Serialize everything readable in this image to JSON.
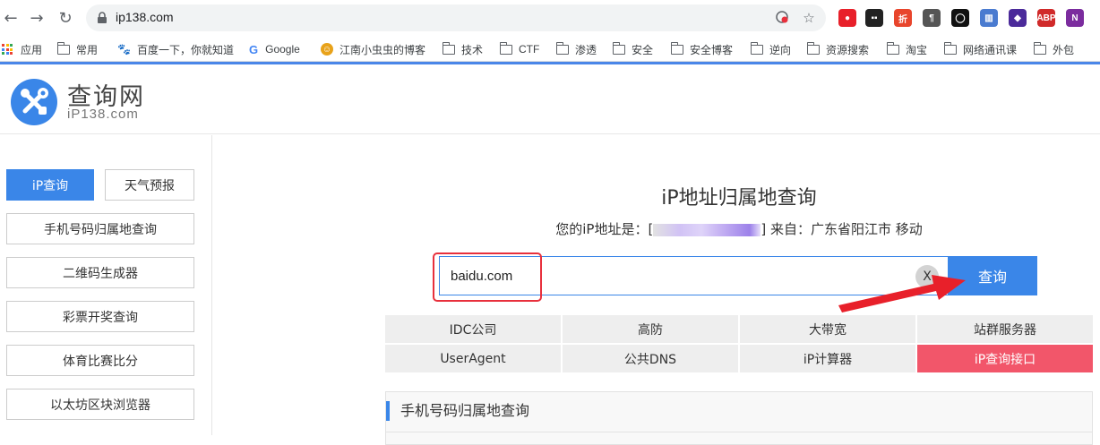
{
  "browser": {
    "url": "ip138.com",
    "nav": {
      "back": "←",
      "forward": "→",
      "reload": "↻"
    },
    "extensions": [
      {
        "name": "ublock-icon",
        "label": "●",
        "color": "#e8202a"
      },
      {
        "name": "tampermonkey-icon",
        "label": "▪▪",
        "color": "#222222"
      },
      {
        "name": "zhe-icon",
        "label": "折",
        "color": "#e8452c"
      },
      {
        "name": "pilcrow-icon",
        "label": "¶",
        "color": "#555555"
      },
      {
        "name": "circle-icon",
        "label": "◯",
        "color": "#111111"
      },
      {
        "name": "barcode-icon",
        "label": "▥",
        "color": "#4a7bd0"
      },
      {
        "name": "cube-icon",
        "label": "◆",
        "color": "#4b2a9a"
      },
      {
        "name": "abp-icon",
        "label": "ABP",
        "color": "#d02a2a"
      },
      {
        "name": "onenote-icon",
        "label": "N",
        "color": "#7b2c9e"
      }
    ]
  },
  "bookmarks": [
    {
      "label": "应用",
      "icon": "apps"
    },
    {
      "label": "常用",
      "icon": "folder"
    },
    {
      "label": "百度一下，你就知道",
      "icon": "baidu"
    },
    {
      "label": "Google",
      "icon": "google"
    },
    {
      "label": "江南小虫虫的博客",
      "icon": "blog"
    },
    {
      "label": "技术",
      "icon": "folder"
    },
    {
      "label": "CTF",
      "icon": "folder"
    },
    {
      "label": "渗透",
      "icon": "folder"
    },
    {
      "label": "安全",
      "icon": "folder"
    },
    {
      "label": "安全博客",
      "icon": "folder"
    },
    {
      "label": "逆向",
      "icon": "folder"
    },
    {
      "label": "资源搜索",
      "icon": "folder"
    },
    {
      "label": "淘宝",
      "icon": "folder"
    },
    {
      "label": "网络通讯课",
      "icon": "folder"
    },
    {
      "label": "外包",
      "icon": "folder"
    }
  ],
  "site": {
    "title": "查询网",
    "subtitle": "iP138.com"
  },
  "sidebar": {
    "tabs": [
      "iP查询",
      "天气预报"
    ],
    "items": [
      "手机号码归属地查询",
      "二维码生成器",
      "彩票开奖查询",
      "体育比赛比分",
      "以太坊区块浏览器"
    ]
  },
  "main": {
    "heading": "iP地址归属地查询",
    "your_ip_prefix": "您的iP地址是：[",
    "your_ip_suffix": "] 来自：广东省阳江市 移动",
    "search_value": "baidu.com",
    "clear_label": "X",
    "query_label": "查询",
    "links": [
      "IDC公司",
      "高防",
      "大带宽",
      "站群服务器",
      "UserAgent",
      "公共DNS",
      "iP计算器",
      "iP查询接口"
    ],
    "section_title": "手机号码归属地查询"
  },
  "colors": {
    "accent": "#3a86e8",
    "hot": "#f2566a",
    "annotation": "#e8303c"
  }
}
